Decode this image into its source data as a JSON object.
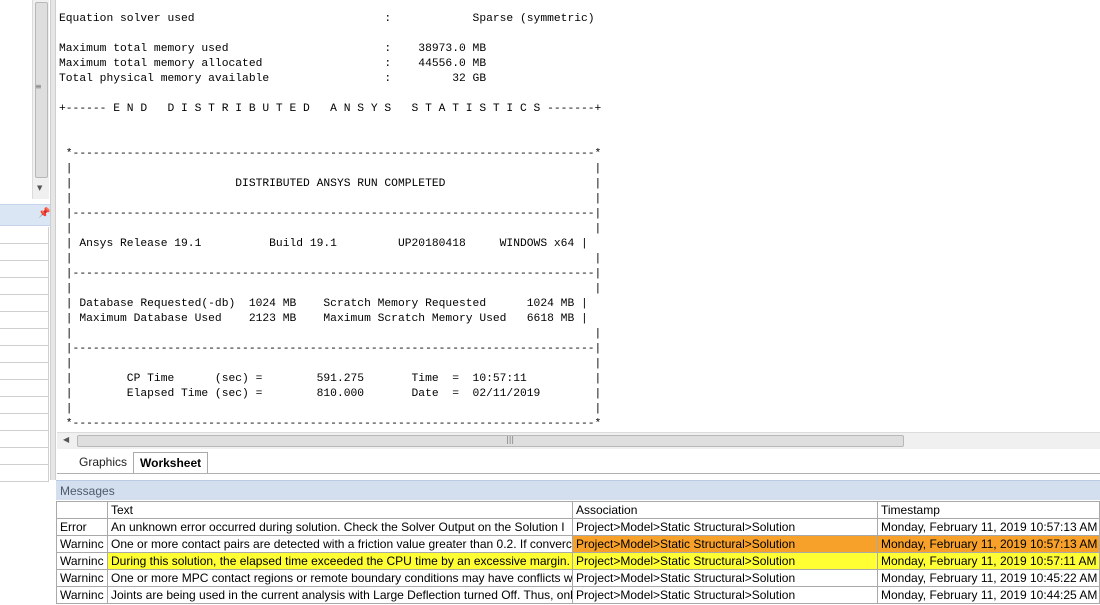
{
  "colors": {
    "orange_highlight": "#f7a12b",
    "yellow_highlight": "#ffff33",
    "messages_header_bg": "#d3dfee"
  },
  "output_lines": [
    "Equation solver used                            :            Sparse (symmetric)",
    "",
    "Maximum total memory used                       :    38973.0 MB",
    "Maximum total memory allocated                  :    44556.0 MB",
    "Total physical memory available                 :         32 GB",
    "",
    "+------ E N D   D I S T R I B U T E D   A N S Y S   S T A T I S T I C S -------+",
    "",
    "",
    " *-----------------------------------------------------------------------------*",
    " |                                                                             |",
    " |                        DISTRIBUTED ANSYS RUN COMPLETED                      |",
    " |                                                                             |",
    " |-----------------------------------------------------------------------------|",
    " |                                                                             |",
    " | Ansys Release 19.1          Build 19.1         UP20180418     WINDOWS x64 |",
    " |                                                                             |",
    " |-----------------------------------------------------------------------------|",
    " |                                                                             |",
    " | Database Requested(-db)  1024 MB    Scratch Memory Requested      1024 MB |",
    " | Maximum Database Used    2123 MB    Maximum Scratch Memory Used   6618 MB |",
    " |                                                                             |",
    " |-----------------------------------------------------------------------------|",
    " |                                                                             |",
    " |        CP Time      (sec) =        591.275       Time  =  10:57:11          |",
    " |        Elapsed Time (sec) =        810.000       Date  =  02/11/2019        |",
    " |                                                                             |",
    " *-----------------------------------------------------------------------------*"
  ],
  "tabs": {
    "graphics": "Graphics",
    "worksheet": "Worksheet"
  },
  "messages": {
    "title": "Messages",
    "columns": {
      "type": "",
      "text": "Text",
      "association": "Association",
      "timestamp": "Timestamp"
    },
    "rows": [
      {
        "type": "Error",
        "text": "An unknown error occurred during solution.  Check the Solver Output on the Solution I",
        "association": "Project>Model>Static Structural>Solution",
        "timestamp": "Monday, February 11, 2019 10:57:13 AM",
        "highlight": ""
      },
      {
        "type": "Warninc",
        "text": " One or more contact pairs are detected with a friction value greater than 0.2. If converc",
        "association": "Project>Model>Static Structural>Solution",
        "timestamp": "Monday, February 11, 2019 10:57:13 AM",
        "highlight": "orange"
      },
      {
        "type": "Warninc",
        "text": "During this solution, the elapsed time exceeded the CPU time by an excessive margin.  (",
        "association": "Project>Model>Static Structural>Solution",
        "timestamp": "Monday, February 11, 2019 10:57:11 AM",
        "highlight": "yellow"
      },
      {
        "type": "Warninc",
        "text": "One or more MPC contact regions or remote boundary conditions may have conflicts w",
        "association": "Project>Model>Static Structural>Solution",
        "timestamp": "Monday, February 11, 2019 10:45:22 AM",
        "highlight": ""
      },
      {
        "type": "Warninc",
        "text": "Joints are being used in the current analysis with Large Deflection turned Off.  Thus, onl",
        "association": "Project>Model>Static Structural>Solution",
        "timestamp": "Monday, February 11, 2019 10:44:25 AM",
        "highlight": ""
      }
    ]
  }
}
